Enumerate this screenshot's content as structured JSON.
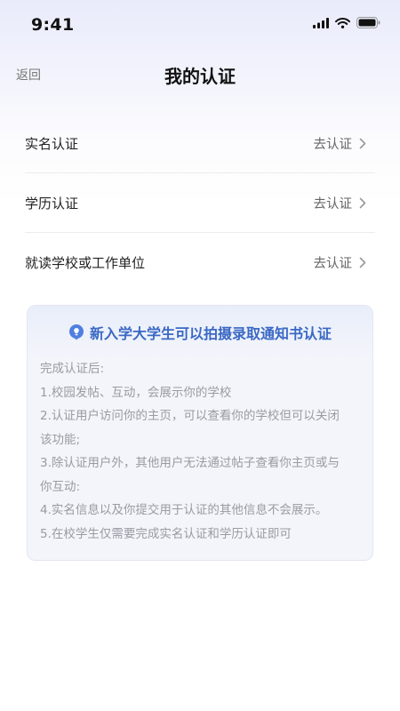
{
  "status_bar": {
    "time": "9:41",
    "signal_icon": "cellular-signal-icon",
    "wifi_icon": "wifi-icon",
    "battery_icon": "battery-icon"
  },
  "nav": {
    "back_label": "返回",
    "title": "我的认证"
  },
  "certifications": [
    {
      "name": "实名认证",
      "action": "去认证",
      "icon": "chevron-right-icon"
    },
    {
      "name": "学历认证",
      "action": "去认证",
      "icon": "chevron-right-icon"
    },
    {
      "name": "就读学校或工作单位",
      "action": "去认证",
      "icon": "chevron-right-icon"
    }
  ],
  "info_card": {
    "icon": "lightbulb-icon",
    "header": "新入学大学生可以拍摄录取通知书认证",
    "lines": [
      "完成认证后:",
      "1.校园发帖、互动，会展示你的学校",
      "2.认证用户访问你的主页，可以查看你的学校但可以关闭",
      "该功能;",
      "3.除认证用户外，其他用户无法通过帖子查看你主页或与",
      "你互动:",
      "4.实名信息以及你提交用于认证的其他信息不会展示。",
      "5.在校学生仅需要完成实名认证和学历认证即可"
    ]
  },
  "colors": {
    "accent": "#3a68c4",
    "muted_text": "#9a9aa2",
    "card_background": "#f4f5fb"
  }
}
